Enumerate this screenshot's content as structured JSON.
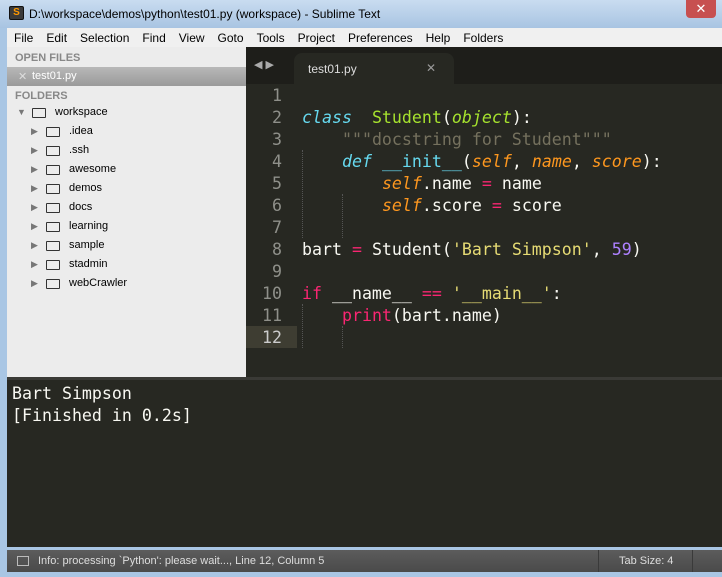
{
  "window": {
    "title": "D:\\workspace\\demos\\python\\test01.py (workspace) - Sublime Text",
    "close": "✕"
  },
  "menu": [
    "File",
    "Edit",
    "Selection",
    "Find",
    "View",
    "Goto",
    "Tools",
    "Project",
    "Preferences",
    "Help",
    "Folders"
  ],
  "sidebar": {
    "open_files_label": "OPEN FILES",
    "open_files": [
      {
        "name": "test01.py",
        "close": "✕"
      }
    ],
    "folders_label": "FOLDERS",
    "root": "workspace",
    "folders": [
      ".idea",
      ".ssh",
      "awesome",
      "demos",
      "docs",
      "learning",
      "sample",
      "stadmin",
      "webCrawler"
    ]
  },
  "tabs": {
    "nav": "◀ ▶",
    "active": {
      "name": "test01.py",
      "close": "✕"
    }
  },
  "editor": {
    "current_line": 12,
    "lines": [
      [],
      [
        [
          "st",
          "class"
        ],
        [
          "",
          "  "
        ],
        [
          "cl",
          "Student"
        ],
        [
          "",
          "("
        ],
        [
          "ih",
          "object"
        ],
        [
          "",
          "):"
        ]
      ],
      [
        [
          "",
          "    "
        ],
        [
          "c",
          "\"\"\"docstring for Student\"\"\""
        ]
      ],
      [
        [
          "",
          "    "
        ],
        [
          "st",
          "def"
        ],
        [
          "",
          " "
        ],
        [
          "f",
          "__init__"
        ],
        [
          "",
          "("
        ],
        [
          "p",
          "self"
        ],
        [
          "",
          ", "
        ],
        [
          "p",
          "name"
        ],
        [
          "",
          ", "
        ],
        [
          "p",
          "score"
        ],
        [
          "",
          "):"
        ]
      ],
      [
        [
          "",
          "        "
        ],
        [
          "p",
          "self"
        ],
        [
          "",
          ".name "
        ],
        [
          "kw",
          "="
        ],
        [
          "",
          " name"
        ]
      ],
      [
        [
          "",
          "        "
        ],
        [
          "p",
          "self"
        ],
        [
          "",
          ".score "
        ],
        [
          "kw",
          "="
        ],
        [
          "",
          " score"
        ]
      ],
      [],
      [
        [
          "",
          "bart "
        ],
        [
          "kw",
          "="
        ],
        [
          "",
          " Student("
        ],
        [
          "s",
          "'Bart Simpson'"
        ],
        [
          "",
          ", "
        ],
        [
          "n",
          "59"
        ],
        [
          "",
          ")"
        ]
      ],
      [],
      [
        [
          "kw",
          "if"
        ],
        [
          "",
          " __name__ "
        ],
        [
          "kw",
          "=="
        ],
        [
          "",
          " "
        ],
        [
          "s",
          "'__main__'"
        ],
        [
          "",
          ":"
        ]
      ],
      [
        [
          "",
          "    "
        ],
        [
          "b",
          "print"
        ],
        [
          "",
          "(bart.name)"
        ]
      ],
      []
    ]
  },
  "output": {
    "lines": [
      "Bart Simpson",
      "[Finished in 0.2s]"
    ]
  },
  "status": {
    "info": "Info: processing `Python': please wait..., Line 12, Column 5",
    "tab_size": "Tab Size: 4"
  }
}
